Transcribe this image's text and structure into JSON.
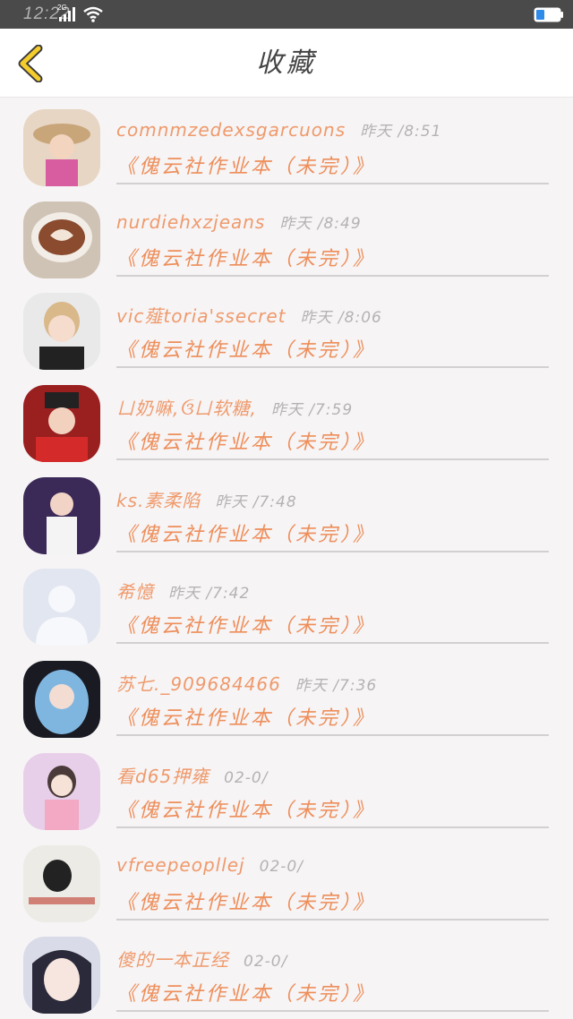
{
  "status_bar": {
    "time": "12:22",
    "network": "2G"
  },
  "header": {
    "title": "收藏"
  },
  "colors": {
    "accent": "#ee8e5a",
    "back_icon": "#f4cc2c",
    "time_text": "#b4b2b3"
  },
  "items": [
    {
      "name": "comnmzedexsgarcuons",
      "time": "昨天 /8:51",
      "book": "《傀云社作业本（未完）》"
    },
    {
      "name": "nurdiehxzjeans",
      "time": "昨天 /8:49",
      "book": "《傀云社作业本（未完）》"
    },
    {
      "name": "vic薤toria'ssecret",
      "time": "昨天 /8:06",
      "book": "《傀云社作业本（未完）》"
    },
    {
      "name": "ㄩ奶嘛,ઉㄩ软糖,",
      "time": "昨天 /7:59",
      "book": "《傀云社作业本（未完）》"
    },
    {
      "name": "ks.素柔陷",
      "time": "昨天 /7:48",
      "book": "《傀云社作业本（未完）》"
    },
    {
      "name": "希憶",
      "time": "昨天 /7:42",
      "book": "《傀云社作业本（未完）》"
    },
    {
      "name": "苏七._909684466",
      "time": "昨天 /7:36",
      "book": "《傀云社作业本（未完）》"
    },
    {
      "name": "看d65押雍",
      "time": "02-0/",
      "book": "《傀云社作业本（未完）》"
    },
    {
      "name": "vfreepeopllej",
      "time": "02-0/",
      "book": "《傀云社作业本（未完）》"
    },
    {
      "name": "傻的一本正经",
      "time": "02-0/",
      "book": "《傀云社作业本（未完）》"
    }
  ]
}
